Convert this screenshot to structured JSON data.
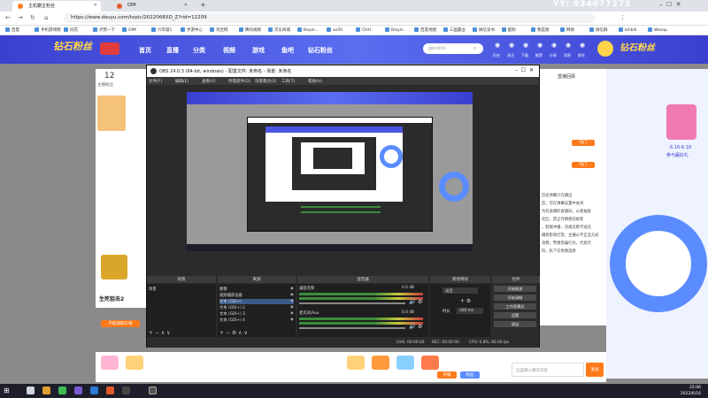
{
  "browser": {
    "tabs": [
      {
        "label": "主机霸主粉丝",
        "active": true
      },
      {
        "label": "OIM",
        "active": false
      }
    ],
    "new_tab": "+",
    "url": "https://www.douyu.com/topic/2022068XD_Z?rid=12209",
    "bookmarks": [
      "百度",
      "手机游戏网",
      "同花",
      "点赞一下",
      "OIM",
      "六年级1",
      "手游中心",
      "淘宝网",
      "腾讯视频",
      "京东商城",
      "Bayer...",
      "ax50",
      "CHH",
      "Baiyin",
      "百度地图",
      "三国霸业",
      "微信读书",
      "酷狗",
      "我是歌",
      "网易",
      "微信群",
      "bilibili",
      "Wasap"
    ],
    "watermark": "YY: 934077375"
  },
  "site": {
    "nav": [
      "首页",
      "直播",
      "分类",
      "视频",
      "游戏",
      "鱼吧",
      "钻石粉丝"
    ],
    "search_placeholder": "genshin",
    "header_icons": [
      "历史",
      "关注",
      "下载",
      "推荐",
      "分享",
      "消息",
      "前往"
    ],
    "brand": "钻石粉丝",
    "left_count": "12",
    "left_label": "主播粉丝",
    "room_tag": "直播回顾",
    "hot_label": "热门",
    "date_range": "6.16-6.18",
    "promo": "参与赢好礼",
    "right_text": [
      "历史弹幕只在播出",
      "后，可在弹幕设置中关闭",
      "为有直播的直播间，从者抽放",
      "社区，禁止作情相违规者",
      "，假惺冲播，违规迅断不准违",
      "播将影响打赏，主播以不正当方式",
      "消费，警惕受骗行为，代发代",
      "料，私下交易慎选择"
    ],
    "gift_label": "不能领取礼物",
    "product": "生死狙击2",
    "chat_placeholder": "这里输入聊天内容",
    "send": "发送",
    "bottom_btns": [
      "开播",
      "粉丝"
    ]
  },
  "obs": {
    "title": "OBS 24.0.3 (64-bit, windows) - 配置文件: 未命名 - 场景: 未命名",
    "menu": [
      "文件(F)",
      "编辑(E)",
      "查看(V)",
      "停靠部件(D)",
      "场景集合(S)",
      "工具(T)",
      "帮助(H)"
    ],
    "docks": [
      "场景",
      "来源",
      "混音器",
      "转场特效",
      "控件"
    ],
    "scenes": [
      "场景"
    ],
    "sources": [
      "图像",
      "视频捕获设备",
      "文本 (GDI+)",
      "文本 (GDI+) 2",
      "文本 (GDI+) 3",
      "文本 (GDI+) 4"
    ],
    "mixer": [
      {
        "name": "桌面音频",
        "db": "0.0 dB"
      },
      {
        "name": "麦克风/Aux",
        "db": "0.0 dB"
      }
    ],
    "transition": {
      "type": "淡出",
      "duration_label": "时长",
      "duration": "300 ms"
    },
    "controls": [
      "开始推流",
      "开始录制",
      "工作室模式",
      "设置",
      "退出"
    ],
    "status": {
      "live": "LIVE: 00:00:00",
      "rec": "REC: 00:00:00",
      "cpu": "CPU: 0.8%, 60.00 fps"
    }
  },
  "taskbar": {
    "time": "22:06",
    "date": "2022/6/16"
  },
  "colors": {
    "brand_blue": "#3a3fd0",
    "orange": "#ff7a1a",
    "obs_bg": "#2b2b2b"
  }
}
